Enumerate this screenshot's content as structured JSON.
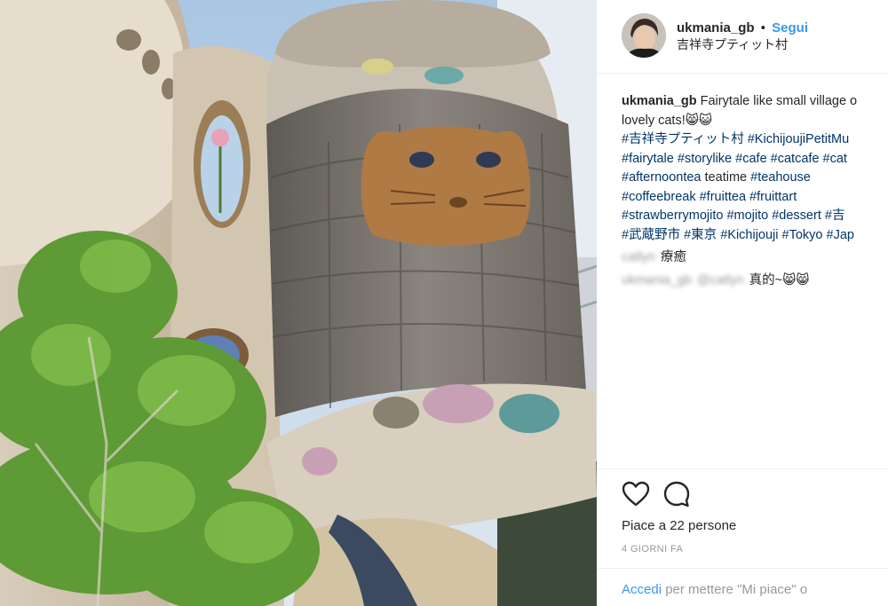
{
  "post": {
    "username": "ukmania_gb",
    "follow_label": "Segui",
    "separator": "•",
    "location": "吉祥寺プティット村"
  },
  "caption": {
    "username": "ukmania_gb",
    "line1": "Fairytale like small village o",
    "line2": "lovely cats!😸😺",
    "line3": [
      "#吉祥寺プティット村",
      "#KichijoujiPetitMu"
    ],
    "line4": [
      "#fairytale",
      "#storylike",
      "#cafe",
      "#catcafe",
      "#cat"
    ],
    "line5_tag1": "#afternoontea",
    "line5_text": "teatime",
    "line5_tag2": "#teahouse",
    "line6": [
      "#coffeebreak",
      "#fruittea",
      "#fruittart"
    ],
    "line7": [
      "#strawberrymojito",
      "#mojito",
      "#dessert",
      "#吉"
    ],
    "line8": [
      "#武蔵野市",
      "#東京",
      "#Kichijouji",
      "#Tokyo",
      "#Jap"
    ]
  },
  "comments": [
    {
      "user": "catlyn",
      "mention": "",
      "text": "療癒"
    },
    {
      "user": "ukmania_gb",
      "mention": "@catlyn",
      "text": "真的~😸😸"
    }
  ],
  "actions": {
    "like_icon": "heart-icon",
    "comment_icon": "comment-icon"
  },
  "likes_text": "Piace a 22 persone",
  "time_text": "4 GIORNI FA",
  "login": {
    "link": "Accedi",
    "rest": "per mettere \"Mi piace\" o"
  }
}
